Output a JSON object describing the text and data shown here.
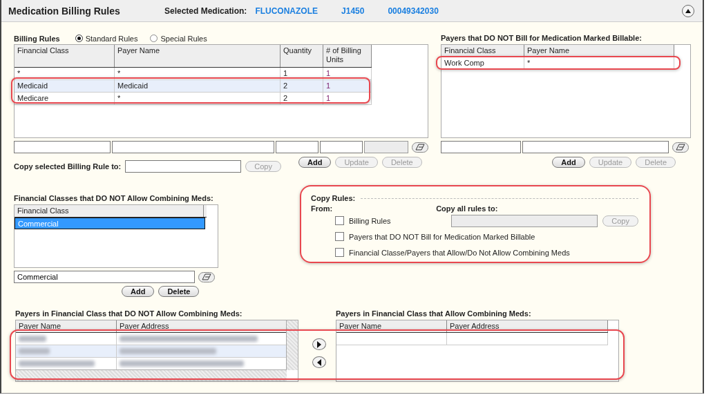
{
  "header": {
    "title": "Medication Billing Rules",
    "selected_label": "Selected Medication:",
    "medication": [
      "FLUCONAZOLE",
      "J1450",
      "00049342030"
    ]
  },
  "billing_rules": {
    "label": "Billing Rules",
    "options": [
      {
        "label": "Standard Rules",
        "selected": true
      },
      {
        "label": "Special Rules",
        "selected": false
      }
    ],
    "columns": [
      "Financial Class",
      "Payer Name",
      "Quantity",
      "# of Billing Units"
    ],
    "rows": [
      {
        "cells": [
          "*",
          "*",
          "1",
          "1"
        ],
        "selected": false
      },
      {
        "cells": [
          "Medicaid",
          "Medicaid",
          "2",
          "1"
        ],
        "selected": true
      },
      {
        "cells": [
          "Medicare",
          "*",
          "2",
          "1"
        ],
        "selected": false
      }
    ],
    "entry_fields": [
      {
        "disabled": false
      },
      {
        "disabled": false
      },
      {
        "disabled": false
      },
      {
        "disabled": false
      },
      {
        "disabled": true
      }
    ],
    "copy_label": "Copy selected Billing Rule to:",
    "copy_button": {
      "label": "Copy",
      "disabled": true
    },
    "buttons": [
      {
        "label": "Add",
        "disabled": false
      },
      {
        "label": "Update",
        "disabled": true
      },
      {
        "label": "Delete",
        "disabled": true
      }
    ]
  },
  "payers_not_bill": {
    "title": "Payers that DO NOT Bill for Medication Marked Billable:",
    "columns": [
      "Financial Class",
      "Payer Name"
    ],
    "rows": [
      {
        "cells": [
          "Work Comp",
          "*"
        ],
        "selected": false
      }
    ],
    "buttons": [
      {
        "label": "Add",
        "disabled": false
      },
      {
        "label": "Update",
        "disabled": true
      },
      {
        "label": "Delete",
        "disabled": true
      }
    ]
  },
  "fin_classes": {
    "title": "Financial Classes that DO NOT Allow Combining Meds:",
    "column": "Financial Class",
    "rows": [
      {
        "label": "Commercial",
        "selected": true
      }
    ],
    "field_value": "Commercial",
    "buttons": [
      {
        "label": "Add",
        "disabled": false
      },
      {
        "label": "Delete",
        "disabled": false
      }
    ]
  },
  "copy_rules": {
    "title": "Copy Rules:",
    "from_label": "From:",
    "to_label": "Copy all rules to:",
    "to_field": {
      "disabled": true
    },
    "copy_button": {
      "label": "Copy",
      "disabled": true
    },
    "options": [
      {
        "label": "Billing Rules",
        "checked": false
      },
      {
        "label": "Payers that DO NOT Bill for Medication Marked Billable",
        "checked": false
      },
      {
        "label": "Financial Classe/Payers that Allow/Do Not Allow Combining Meds",
        "checked": false
      }
    ]
  },
  "payers_not_allow": {
    "title": "Payers in Financial Class that DO NOT Allow Combining Meds:",
    "columns": [
      "Payer Name",
      "Payer Address"
    ],
    "rows": [
      {
        "selected": false
      },
      {
        "selected": true
      },
      {
        "selected": false
      }
    ]
  },
  "payers_allow": {
    "title": "Payers in Financial Class that Allow Combining Meds:",
    "columns": [
      "Payer Name",
      "Payer Address"
    ],
    "rows": [
      {
        "selected": false
      }
    ]
  }
}
